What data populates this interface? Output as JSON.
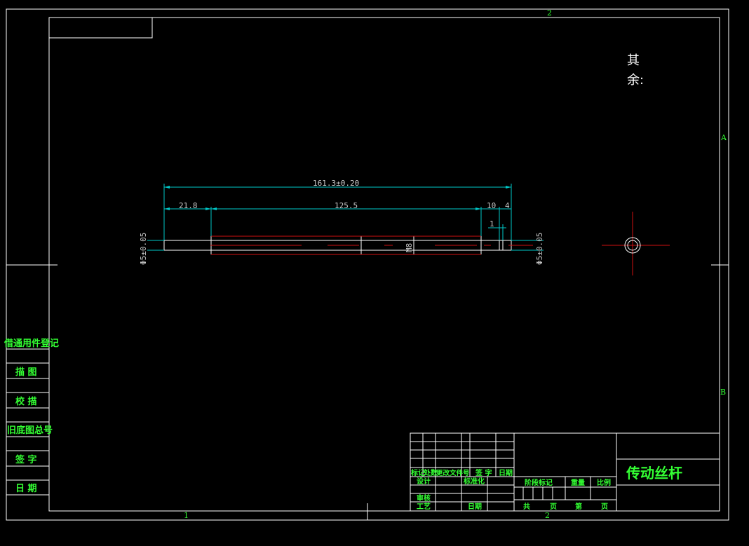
{
  "zones": {
    "top_2": "2",
    "bottom_1": "1",
    "bottom_2": "2",
    "right_a": "A",
    "right_b": "B"
  },
  "note": {
    "line1": "其",
    "line2": "余:"
  },
  "dimensions": {
    "overall": "161.3±0.20",
    "d1": "21.8",
    "d2": "125.5",
    "d3": "10",
    "d4": "4",
    "d5": "1",
    "thread": "M8",
    "dia_left": "Φ5±0.05",
    "dia_right": "Φ5±0.05"
  },
  "left_panel": {
    "items": [
      "借通用件登记",
      "描 图",
      "校 描",
      "旧底图总号",
      "签 字",
      "日 期"
    ]
  },
  "title_block": {
    "title": "传动丝杆",
    "labels": {
      "mark": "标记",
      "count": "处数",
      "change_doc": "更改文件号",
      "sign": "签 字",
      "date": "日期",
      "design": "设计",
      "standard": "标准化",
      "review": "审核",
      "process": "工艺",
      "date2": "日期",
      "stage_mark": "阶段标记",
      "weight": "重量",
      "scale": "比例",
      "total": "共",
      "page": "页",
      "sheet_no": "第",
      "page2": "页"
    }
  },
  "colors": {
    "background": "#000000",
    "frame": "#ffffff",
    "dimension": "#00c8c8",
    "centerline": "#d01010",
    "text": "#33ff33"
  }
}
